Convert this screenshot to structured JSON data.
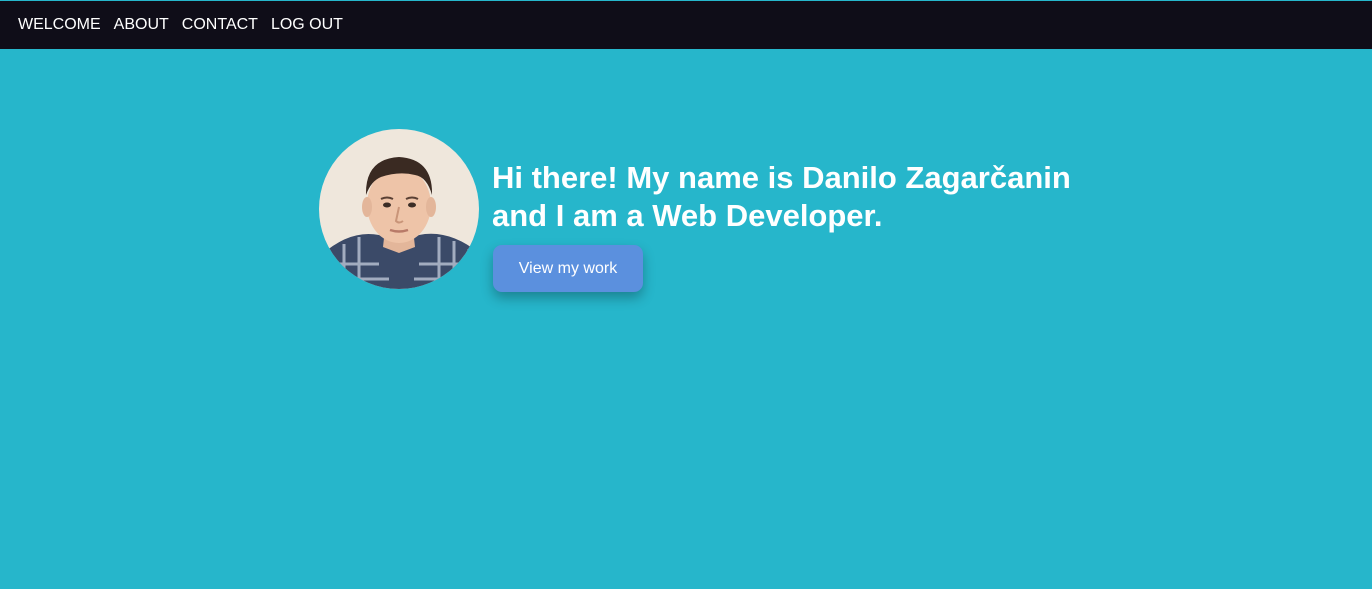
{
  "nav": {
    "items": [
      "WELCOME",
      "ABOUT",
      "CONTACT",
      "LOG OUT"
    ]
  },
  "hero": {
    "headline_line1": "Hi there! My name is Danilo Zagarčanin",
    "headline_line2": "and I am a Web Developer.",
    "button_label": "View my work",
    "avatar_icon": "profile-photo"
  },
  "colors": {
    "background": "#26b6cb",
    "navbar": "#0f0d18",
    "button": "#5b90de",
    "text": "#ffffff"
  }
}
